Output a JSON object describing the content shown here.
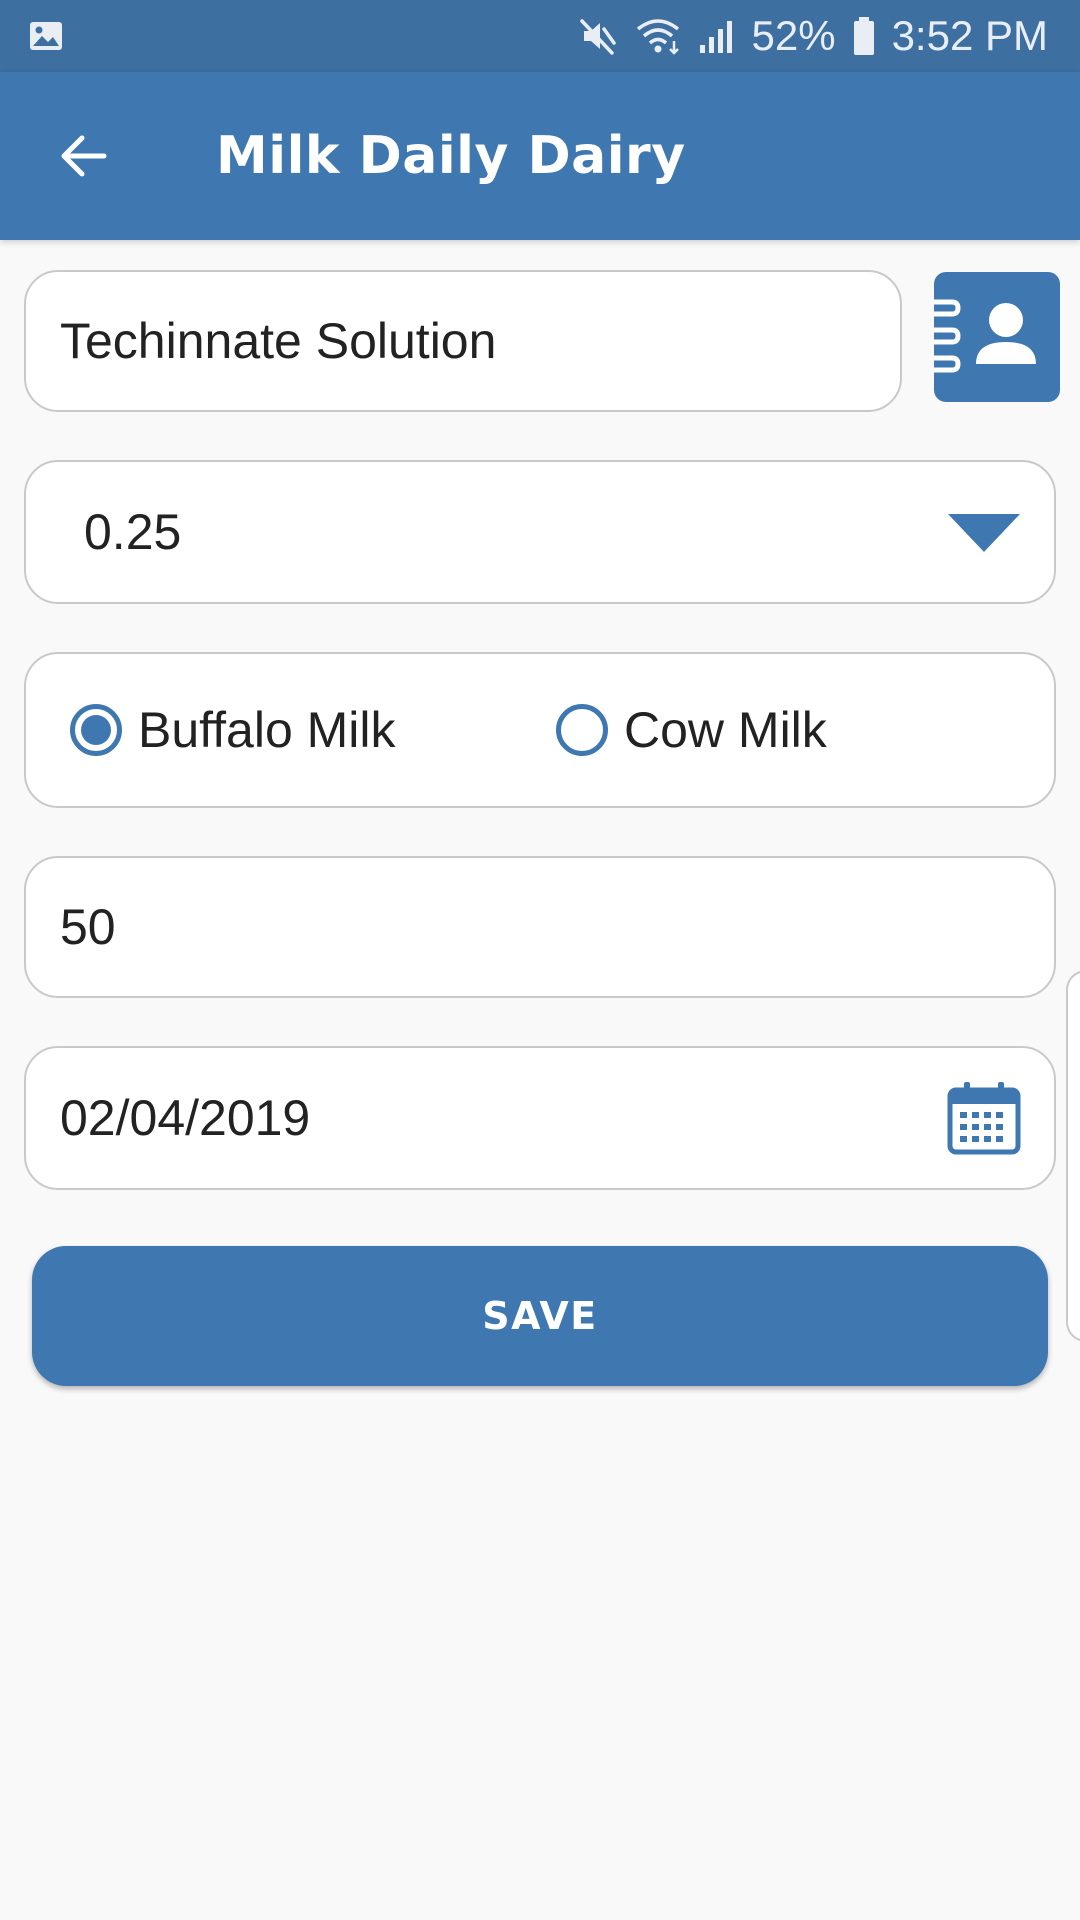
{
  "status_bar": {
    "battery_percent": "52%",
    "time": "3:52 PM",
    "icons": [
      "image-icon",
      "mute-icon",
      "wifi-icon",
      "signal-icon",
      "battery-icon"
    ]
  },
  "app_bar": {
    "title": "Milk Daily Dairy",
    "back_icon": "arrow-left-icon"
  },
  "form": {
    "customer_name": "Techinnate Solution",
    "contacts_icon": "contact-book-icon",
    "quantity": "0.25",
    "milk_types": [
      {
        "label": "Buffalo Milk",
        "selected": true
      },
      {
        "label": "Cow Milk",
        "selected": false
      }
    ],
    "amount": "50",
    "date": "02/04/2019",
    "calendar_icon": "calendar-icon",
    "save_label": "SAVE"
  },
  "colors": {
    "status_bar": "#3d6fa1",
    "app_bar": "#3f78b0",
    "accent": "#3f78b0",
    "background": "#f9f9f9",
    "field_border": "#c9c9c9"
  }
}
